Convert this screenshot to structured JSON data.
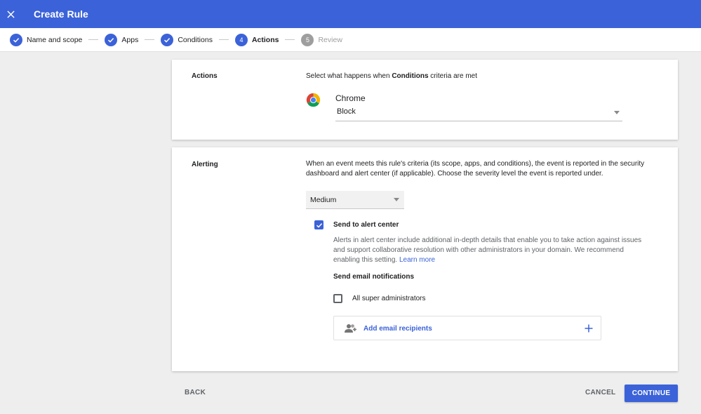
{
  "header": {
    "title": "Create Rule",
    "close_icon": "close-icon",
    "background": "#3b62d8"
  },
  "stepper": {
    "steps": [
      {
        "label": "Name and scope",
        "state": "done"
      },
      {
        "label": "Apps",
        "state": "done"
      },
      {
        "label": "Conditions",
        "state": "done"
      },
      {
        "label": "Actions",
        "state": "active",
        "number": "4"
      },
      {
        "label": "Review",
        "state": "pending",
        "number": "5"
      }
    ]
  },
  "actions": {
    "section_label": "Actions",
    "description_prefix": "Select what happens when ",
    "description_bold": "Conditions",
    "description_suffix": " criteria are met",
    "app_name": "Chrome",
    "app_icon": "chrome-icon",
    "action_value": "Block"
  },
  "alerting": {
    "section_label": "Alerting",
    "description": "When an event meets this rule's criteria (its scope, apps, and conditions), the event is reported in the security dashboard and alert center (if applicable). Choose the severity level the event is reported under.",
    "severity_value": "Medium",
    "send_to_alert_center_label": "Send to alert center",
    "send_to_alert_center_checked": true,
    "alert_center_help": "Alerts in alert center include additional in-depth details that enable you to take action against issues and support collaborative resolution with other administrators in your domain. We recommend enabling this setting.",
    "learn_more": "Learn more",
    "email_notifications_heading": "Send email notifications",
    "super_admins_label": "All super administrators",
    "super_admins_checked": false,
    "add_recipients_label": "Add email recipients"
  },
  "footer": {
    "back_label": "BACK",
    "cancel_label": "CANCEL",
    "continue_label": "CONTINUE"
  }
}
